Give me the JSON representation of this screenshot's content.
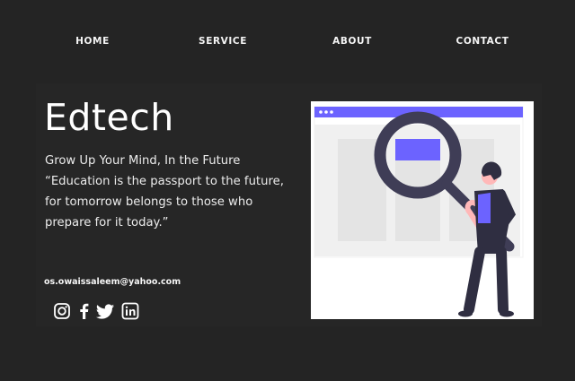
{
  "nav": {
    "home": "HOME",
    "service": "SERVICE",
    "about": "ABOUT",
    "contact": "CONTACT"
  },
  "hero": {
    "title": "Edtech",
    "tagline": "Grow Up Your Mind, In the Future",
    "quote": "“Education is the passport to the future, for tomorrow belongs to those who prepare for it today.”",
    "email": "os.owaissaleem@yahoo.com"
  },
  "social": {
    "icons": [
      "instagram-icon",
      "facebook-icon",
      "twitter-icon",
      "linkedin-icon"
    ]
  },
  "colors": {
    "background": "#242424",
    "accent": "#6c63ff",
    "figure": "#3f3d56"
  }
}
